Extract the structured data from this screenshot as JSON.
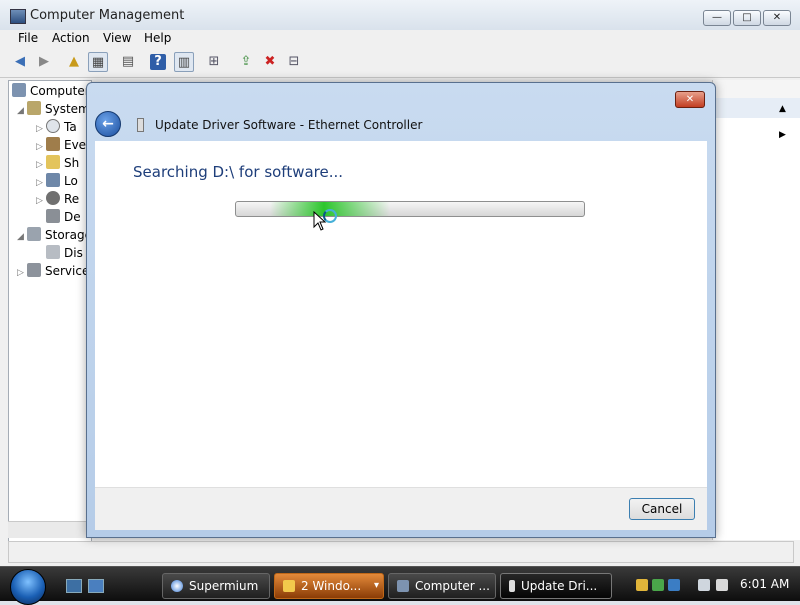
{
  "window": {
    "title": "Computer Management",
    "controls": {
      "minimize": "—",
      "maximize": "□",
      "close": "✕"
    }
  },
  "menu": [
    "File",
    "Action",
    "View",
    "Help"
  ],
  "tree": [
    {
      "label": "Computer",
      "indent": 0
    },
    {
      "label": "System",
      "indent": 1
    },
    {
      "label": "Ta",
      "indent": 2
    },
    {
      "label": "Eve",
      "indent": 2
    },
    {
      "label": "Sh",
      "indent": 2
    },
    {
      "label": "Lo",
      "indent": 2
    },
    {
      "label": "Re",
      "indent": 2
    },
    {
      "label": "De",
      "indent": 2
    },
    {
      "label": "Storage",
      "indent": 1
    },
    {
      "label": "Dis",
      "indent": 2
    },
    {
      "label": "Service",
      "indent": 1
    }
  ],
  "dialog": {
    "title": "Update Driver Software - Ethernet Controller",
    "status": "Searching D:\\ for software...",
    "cancel_label": "Cancel",
    "close": "✕",
    "back": "←",
    "progress_glow_position": 0.27
  },
  "taskbar": {
    "buttons": [
      {
        "label": "Supermium"
      },
      {
        "label": "2 Windo...",
        "chevron": "▾"
      },
      {
        "label": "Computer ..."
      },
      {
        "label": "Update Dri..."
      }
    ],
    "clock": "6:01 AM"
  }
}
